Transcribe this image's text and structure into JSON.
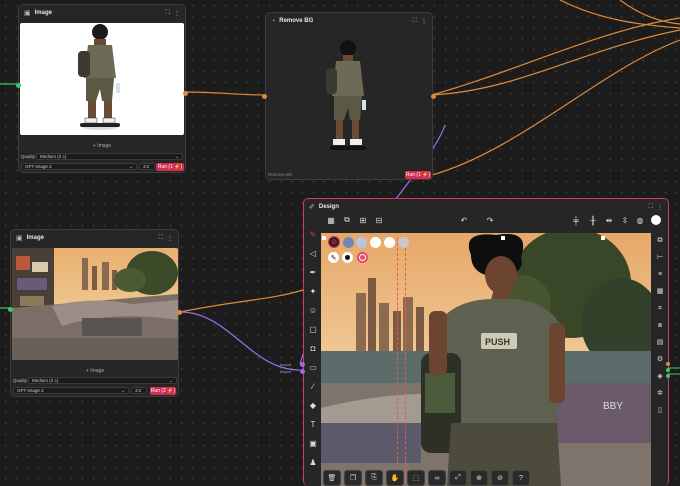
{
  "nodes": {
    "image1": {
      "title": "Image",
      "add_label": "+ Image",
      "quality_label": "Quality",
      "quality_value": "Medium (2 c)",
      "model": "GPT Image 2",
      "ratio": "3:2",
      "run": "Run (1 ⚡)"
    },
    "removebg": {
      "title": "Remove BG",
      "footer": "Remove BG",
      "run": "Run (1 ⚡)"
    },
    "image2": {
      "title": "Image",
      "add_label": "+ Image",
      "quality_label": "Quality",
      "quality_value": "Medium (2 c)",
      "model": "GPT Image 2",
      "ratio": "3:2",
      "run": "Run (2 ⚡)"
    },
    "design": {
      "title": "Design",
      "input_labels": [
        "Import",
        "Import"
      ]
    }
  },
  "canvas_text": {
    "shirt": "PUSH",
    "wall": "BBY"
  },
  "colors": {
    "accent": "#d33a5c",
    "wire_orange": "#e08a3c",
    "wire_purple": "#9b6cf0",
    "swatches": [
      "#6e86b8",
      "#b8c4e0",
      "#ffffff",
      "#ffffff",
      "#c0c0c0"
    ]
  }
}
